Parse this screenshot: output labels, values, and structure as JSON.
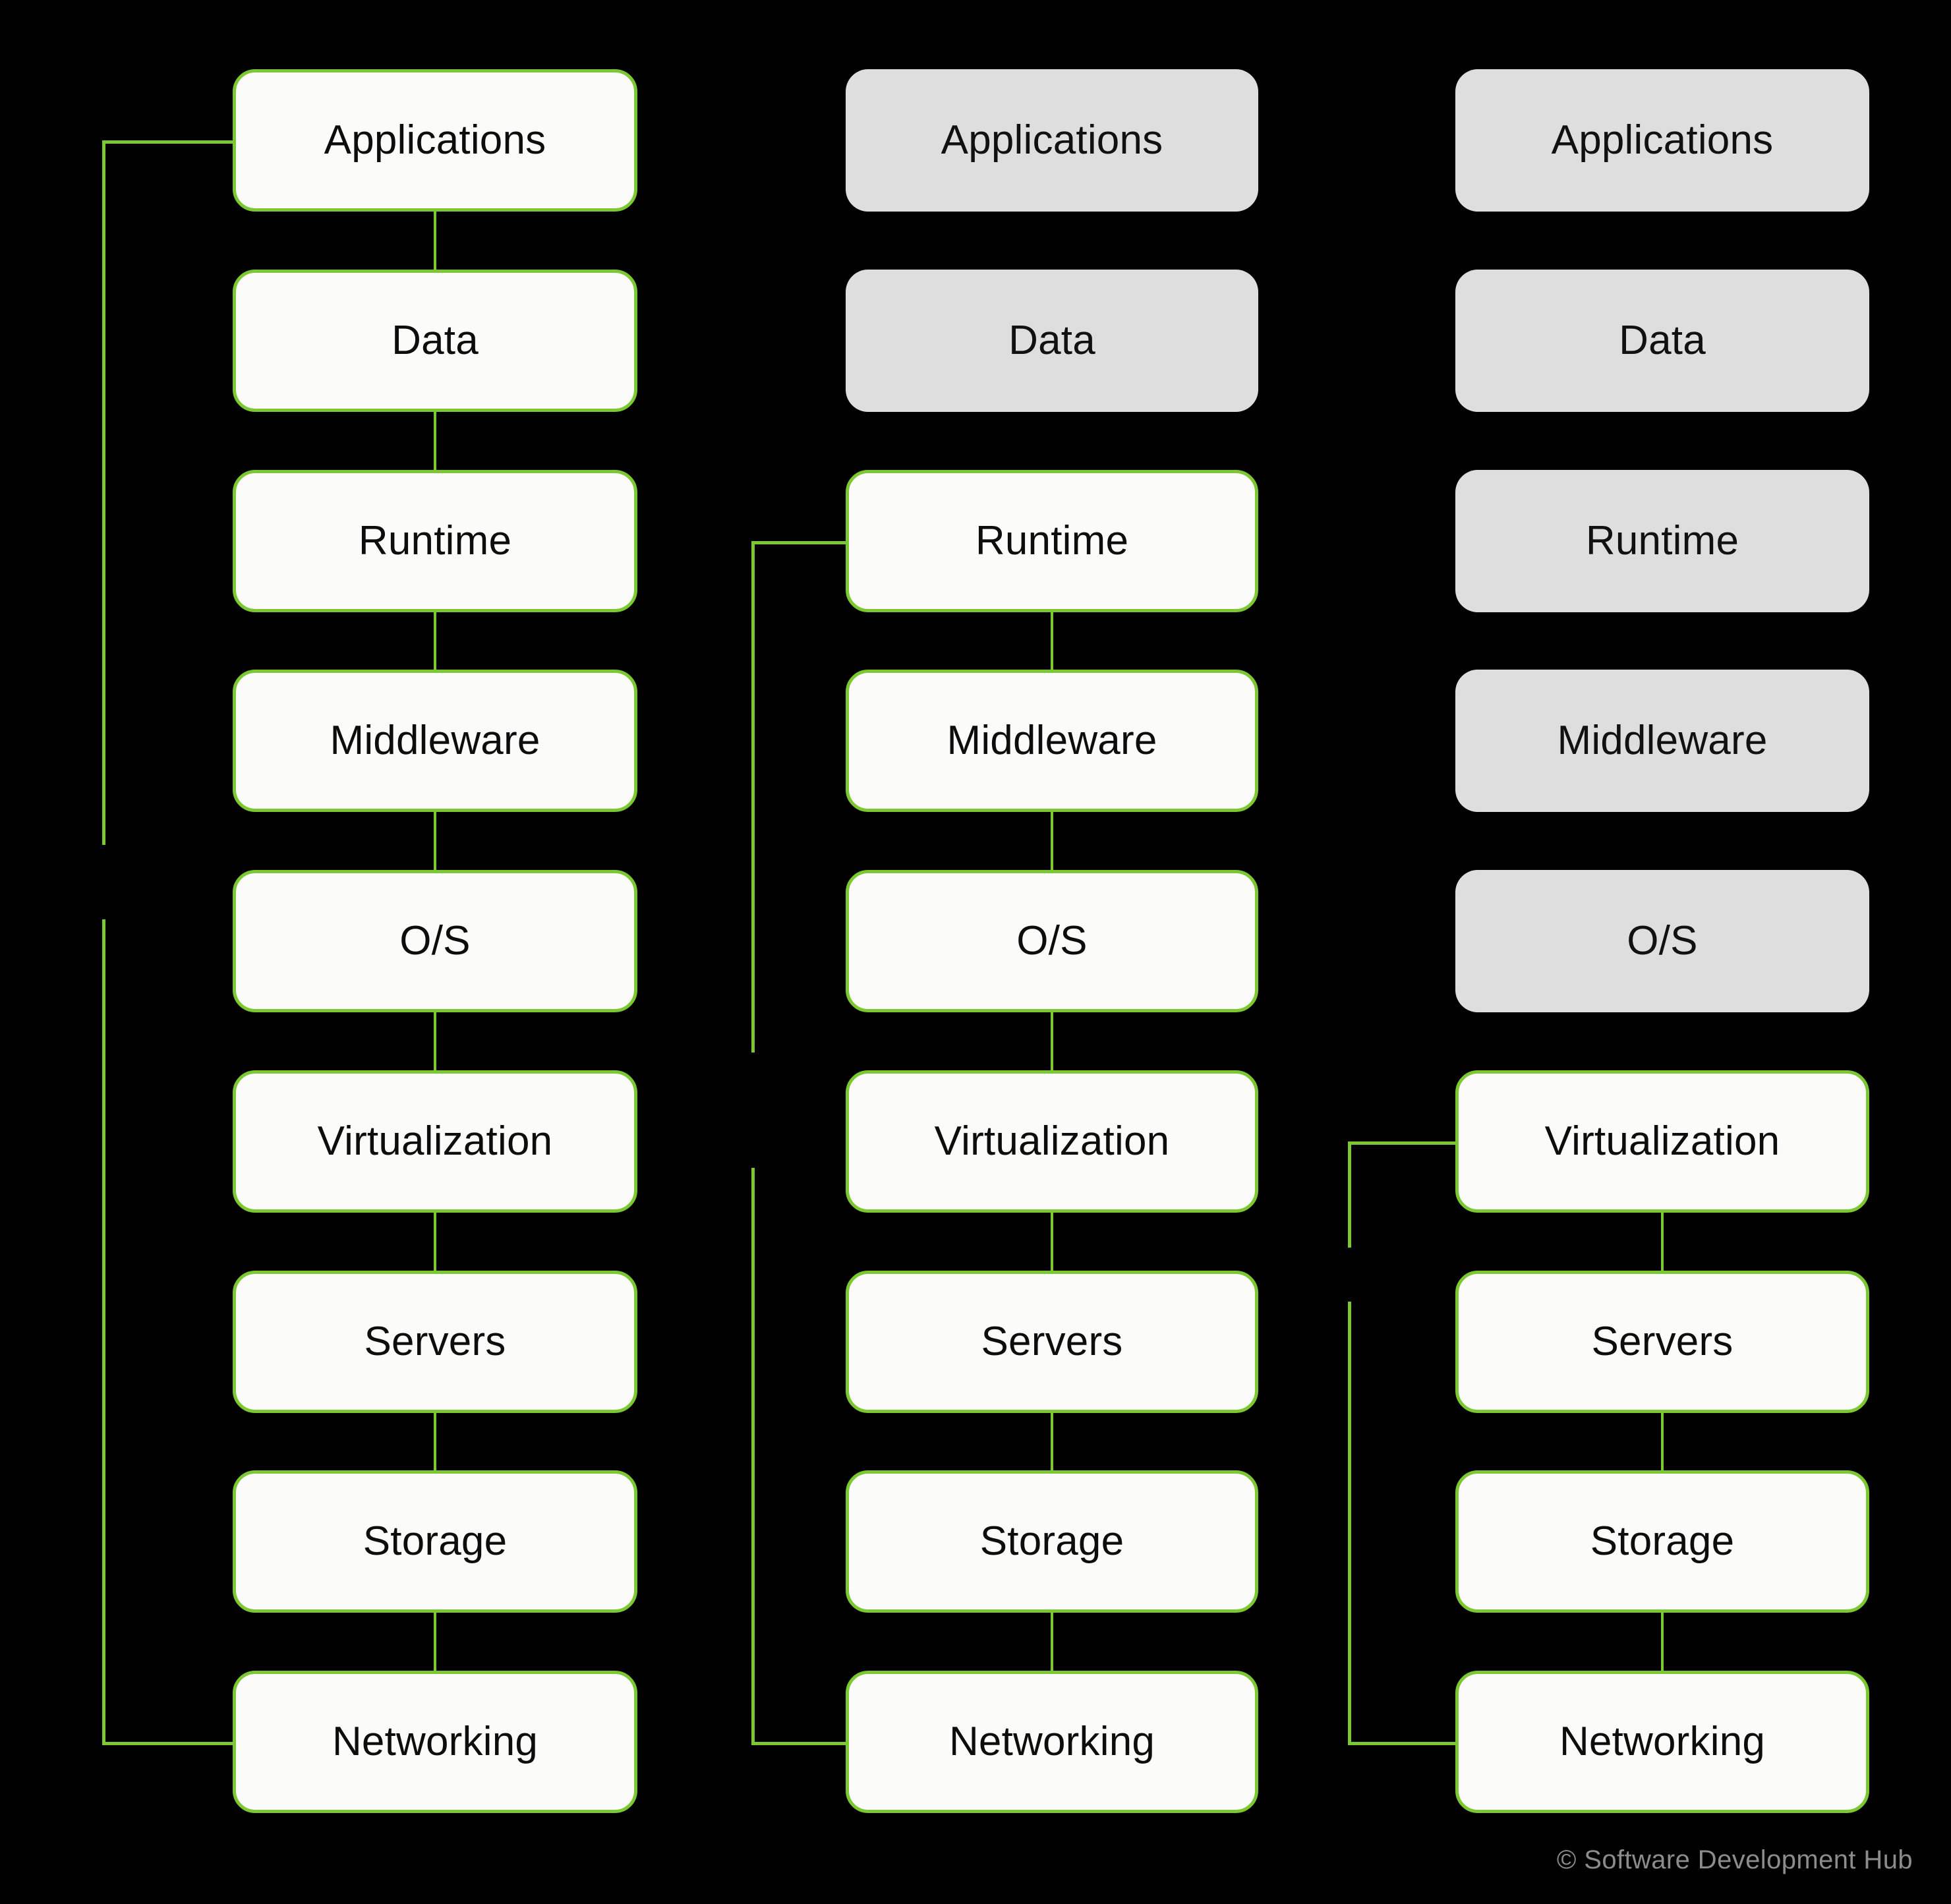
{
  "theme": {
    "background": "#000000",
    "accent_green": "#7cc832",
    "active_box_fill": "#fbfbfa",
    "inactive_box_fill": "#dedede",
    "label_color": "#0d0d0d",
    "watermark_color": "#8c8c8c"
  },
  "layers": [
    "Applications",
    "Data",
    "Runtime",
    "Middleware",
    "O/S",
    "Virtualization",
    "Servers",
    "Storage",
    "Networking"
  ],
  "columns": [
    {
      "name": "column-1",
      "active_from": 0,
      "boxes": [
        {
          "label": "Applications",
          "state": "active"
        },
        {
          "label": "Data",
          "state": "active"
        },
        {
          "label": "Runtime",
          "state": "active"
        },
        {
          "label": "Middleware",
          "state": "active"
        },
        {
          "label": "O/S",
          "state": "active"
        },
        {
          "label": "Virtualization",
          "state": "active"
        },
        {
          "label": "Servers",
          "state": "active"
        },
        {
          "label": "Storage",
          "state": "active"
        },
        {
          "label": "Networking",
          "state": "active"
        }
      ],
      "bracket": {
        "top_row": 0,
        "bottom_row": 8
      }
    },
    {
      "name": "column-2",
      "active_from": 2,
      "boxes": [
        {
          "label": "Applications",
          "state": "inactive"
        },
        {
          "label": "Data",
          "state": "inactive"
        },
        {
          "label": "Runtime",
          "state": "active"
        },
        {
          "label": "Middleware",
          "state": "active"
        },
        {
          "label": "O/S",
          "state": "active"
        },
        {
          "label": "Virtualization",
          "state": "active"
        },
        {
          "label": "Servers",
          "state": "active"
        },
        {
          "label": "Storage",
          "state": "active"
        },
        {
          "label": "Networking",
          "state": "active"
        }
      ],
      "bracket": {
        "top_row": 2,
        "bottom_row": 8
      }
    },
    {
      "name": "column-3",
      "active_from": 5,
      "boxes": [
        {
          "label": "Applications",
          "state": "inactive"
        },
        {
          "label": "Data",
          "state": "inactive"
        },
        {
          "label": "Runtime",
          "state": "inactive"
        },
        {
          "label": "Middleware",
          "state": "inactive"
        },
        {
          "label": "O/S",
          "state": "inactive"
        },
        {
          "label": "Virtualization",
          "state": "active"
        },
        {
          "label": "Servers",
          "state": "active"
        },
        {
          "label": "Storage",
          "state": "active"
        },
        {
          "label": "Networking",
          "state": "active"
        }
      ],
      "bracket": {
        "top_row": 5,
        "bottom_row": 8
      }
    }
  ],
  "watermark": "© Software Development Hub"
}
